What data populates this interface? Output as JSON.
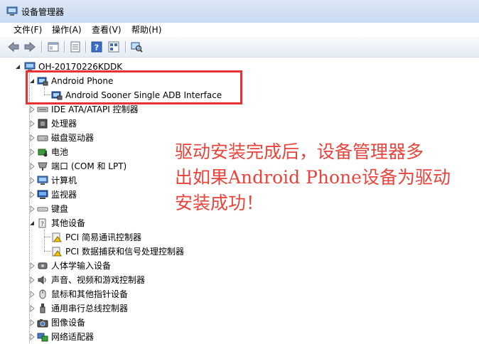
{
  "window": {
    "title": "设备管理器"
  },
  "menu": [
    "文件(F)",
    "操作(A)",
    "查看(V)",
    "帮助(H)"
  ],
  "toolbar": {
    "icons": [
      "back-arrow-icon",
      "forward-arrow-icon",
      "show-hide-tree-icon",
      "properties-icon",
      "help-icon",
      "list-view-icon",
      "scan-hardware-icon"
    ]
  },
  "tree": {
    "root": "OH-20170226KDDK",
    "android_phone": "Android Phone",
    "android_adb": "Android Sooner Single ADB Interface",
    "ide": "IDE ATA/ATAPI 控制器",
    "processor": "处理器",
    "disk": "磁盘驱动器",
    "battery": "电池",
    "port": "端口 (COM 和 LPT)",
    "computer": "计算机",
    "monitor": "监视器",
    "keyboard": "键盘",
    "other": "其他设备",
    "pci_comm": "PCI 简易通讯控制器",
    "pci_data": "PCI 数据捕获和信号处理控制器",
    "hid": "人体学输入设备",
    "sound": "声音、视频和游戏控制器",
    "mouse": "鼠标和其他指针设备",
    "usb": "通用串行总线控制器",
    "imaging": "图像设备",
    "network": "网络适配器"
  },
  "annotation": {
    "line1": "驱动安装完成后，设备管理器多",
    "line2": "出如果Android Phone设备为驱动",
    "line3": "安装成功！",
    "color": "#e8443c"
  }
}
